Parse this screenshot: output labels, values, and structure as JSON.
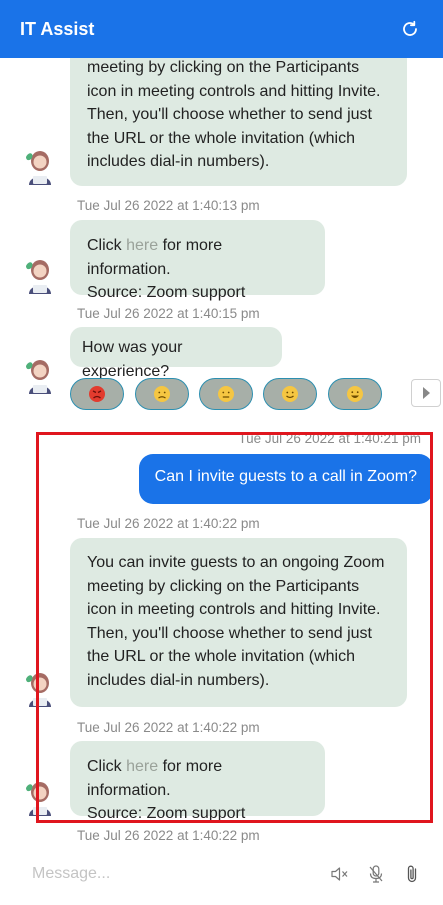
{
  "header": {
    "title": "IT Assist",
    "refresh_icon": "refresh-icon"
  },
  "messages": {
    "m1_text": "meeting by clicking on the Participants icon in meeting controls and hitting Invite. Then, you'll choose whether to send just the URL or the whole invitation (which includes dial-in numbers).",
    "m1_time": "Tue Jul 26 2022 at 1:40:13 pm",
    "m2_pre": "Click ",
    "m2_link": "here",
    "m2_post": " for more information.",
    "m2_source": "Source: Zoom support",
    "m2_time": "Tue Jul 26 2022 at 1:40:15 pm",
    "m3_text": "How was your experience?",
    "feedback": [
      "very-bad-emoji",
      "bad-emoji",
      "neutral-emoji",
      "good-emoji",
      "very-good-emoji"
    ],
    "u1_time": "Tue Jul 26 2022 at 1:40:21 pm",
    "u1_text": "Can I invite guests to a call in Zoom?",
    "m4_time": "Tue Jul 26 2022 at 1:40:22 pm",
    "m4_text": "You can invite guests to an ongoing Zoom meeting by clicking on the Participants icon in meeting controls and hitting Invite. Then, you'll choose whether to send just the URL or the whole invitation (which includes dial-in numbers).",
    "m5_time": "Tue Jul 26 2022 at 1:40:22 pm",
    "m5_pre": "Click ",
    "m5_link": "here",
    "m5_post": " for more information.",
    "m5_source": "Source: Zoom support",
    "m6_time": "Tue Jul 26 2022 at 1:40:22 pm"
  },
  "composer": {
    "placeholder": "Message...",
    "mute_icon": "speaker-mute-icon",
    "mic_icon": "mic-off-icon",
    "attach_icon": "paperclip-icon"
  },
  "colors": {
    "brand": "#1a73e8",
    "bot_bubble": "#deeae2",
    "highlight": "#e0161e"
  }
}
